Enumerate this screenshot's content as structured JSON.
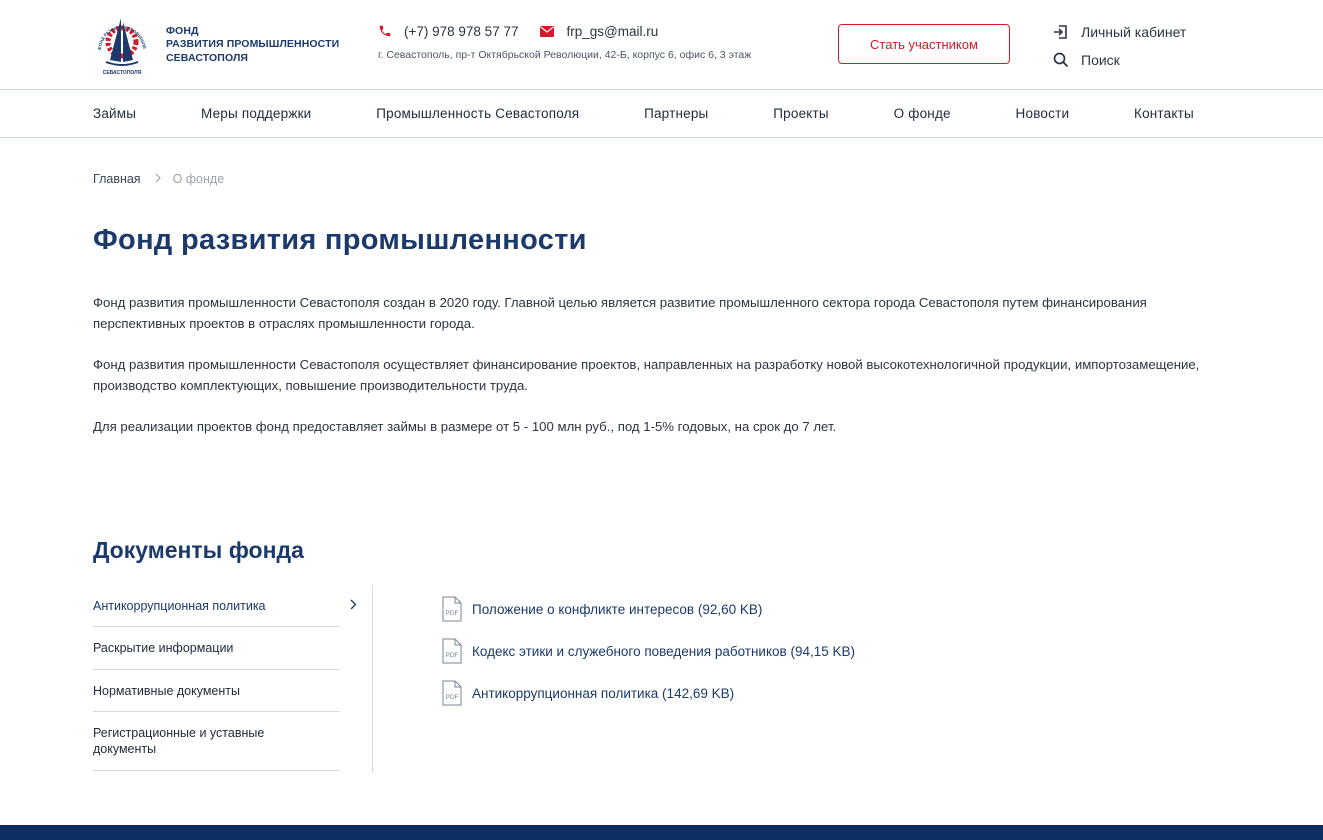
{
  "header": {
    "logo": {
      "line1": "ФОНД",
      "line2": "РАЗВИТИЯ ПРОМЫШЛЕННОСТИ",
      "line3": "СЕВАСТОПОЛЯ",
      "emblem_arc_text": "ФОНД РАЗВИТИЯ ПРОМЫШЛЕННОСТИ",
      "emblem_bottom_text": "СЕВАСТОПОЛЯ"
    },
    "phone": "(+7) 978 978 57 77",
    "email": "frp_gs@mail.ru",
    "address": "г. Севастополь, пр-т Октябрьской Революции, 42-Б, корпус 6, офис 6, 3 этаж",
    "cta_label": "Стать участником",
    "account_label": "Личный кабинет",
    "search_label": "Поиск"
  },
  "nav": {
    "items": [
      "Займы",
      "Меры поддержки",
      "Промышленность Севастополя",
      "Партнеры",
      "Проекты",
      "О фонде",
      "Новости",
      "Контакты"
    ]
  },
  "breadcrumb": {
    "home": "Главная",
    "separator": ">",
    "current": "О фонде"
  },
  "page": {
    "title": "Фонд развития промышленности",
    "paragraphs": [
      "Фонд развития промышленности Севастополя создан в 2020 году. Главной целью является развитие промышленного сектора города Севастополя путем финансирования перспективных проектов в отраслях промышленности города.",
      "Фонд развития промышленности Севастополя осуществляет финансирование проектов, направленных на разработку новой высокотехнологичной продукции, импортозамещение, производство комплектующих, повышение производительности труда.",
      "Для реализации проектов фонд предоставляет займы в размере от 5 - 100 млн руб., под 1-5% годовых, на срок до 7 лет."
    ]
  },
  "documents": {
    "title": "Документы фонда",
    "menu": [
      "Антикоррупционная политика",
      "Раскрытие информации",
      "Нормативные документы",
      "Регистрационные и уставные документы"
    ],
    "active_index": 0,
    "files": [
      "Положение о конфликте интересов (92,60 KB)",
      "Кодекс этики и служебного поведения работников (94,15 KB)",
      "Антикоррупционная политика (142,69 KB)"
    ],
    "file_badge": "PDF"
  },
  "colors": {
    "brand_blue": "#1b3a6b",
    "accent_red": "#d11b2a",
    "footer": "#0e2f63"
  }
}
